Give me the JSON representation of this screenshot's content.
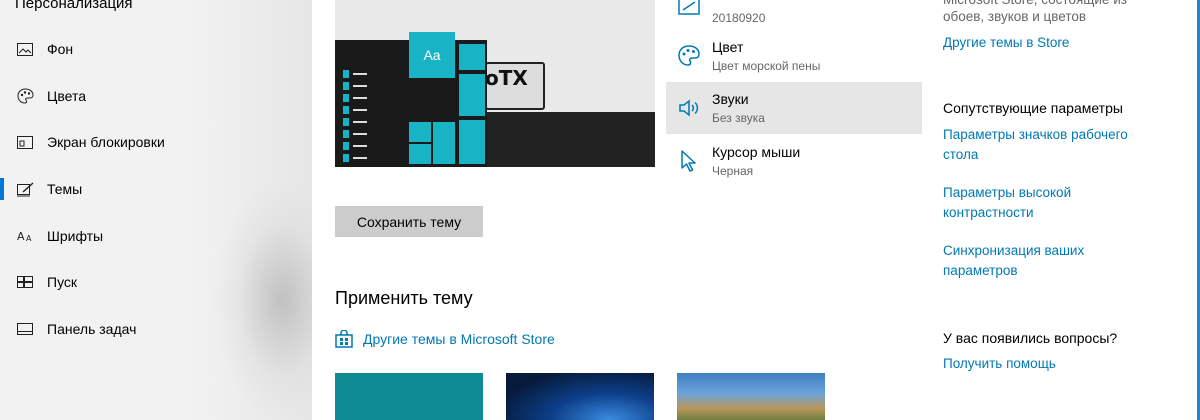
{
  "sidebar": {
    "title": "Персонализация",
    "items": [
      {
        "label": "Фон",
        "icon": "picture-icon"
      },
      {
        "label": "Цвета",
        "icon": "palette-icon"
      },
      {
        "label": "Экран блокировки",
        "icon": "lock-screen-icon"
      },
      {
        "label": "Темы",
        "icon": "themes-icon",
        "active": true
      },
      {
        "label": "Шрифты",
        "icon": "fonts-icon"
      },
      {
        "label": "Пуск",
        "icon": "start-icon"
      },
      {
        "label": "Панель задач",
        "icon": "taskbar-icon"
      }
    ]
  },
  "preview": {
    "tile_label": "Aa",
    "film_text": "oTX"
  },
  "save_button": "Сохранить тему",
  "apply_theme": {
    "title": "Применить тему",
    "store_link": "Другие темы в Microsoft Store"
  },
  "settings": [
    {
      "title": "",
      "subtitle": "20180920",
      "icon": "background-icon"
    },
    {
      "title": "Цвет",
      "subtitle": "Цвет морской пены",
      "icon": "palette-icon"
    },
    {
      "title": "Звуки",
      "subtitle": "Без звука",
      "icon": "speaker-icon"
    },
    {
      "title": "Курсор мыши",
      "subtitle": "Черная",
      "icon": "cursor-icon"
    }
  ],
  "right": {
    "store_desc_1": "Microsoft Store, состоящие из",
    "store_desc_2": "обоев, звуков и цветов",
    "store_link": "Другие темы в Store",
    "related_heading": "Сопутствующие параметры",
    "link_desktop_icons_1": "Параметры значков рабочего",
    "link_desktop_icons_2": "стола",
    "link_contrast_1": "Параметры высокой",
    "link_contrast_2": "контрастности",
    "link_sync_1": "Синхронизация ваших",
    "link_sync_2": "параметров",
    "questions_heading": "У вас появились вопросы?",
    "help_link": "Получить помощь"
  },
  "colors": {
    "accent": "#19b3c6",
    "link": "#0078b4",
    "active_indicator": "#0078d7"
  }
}
